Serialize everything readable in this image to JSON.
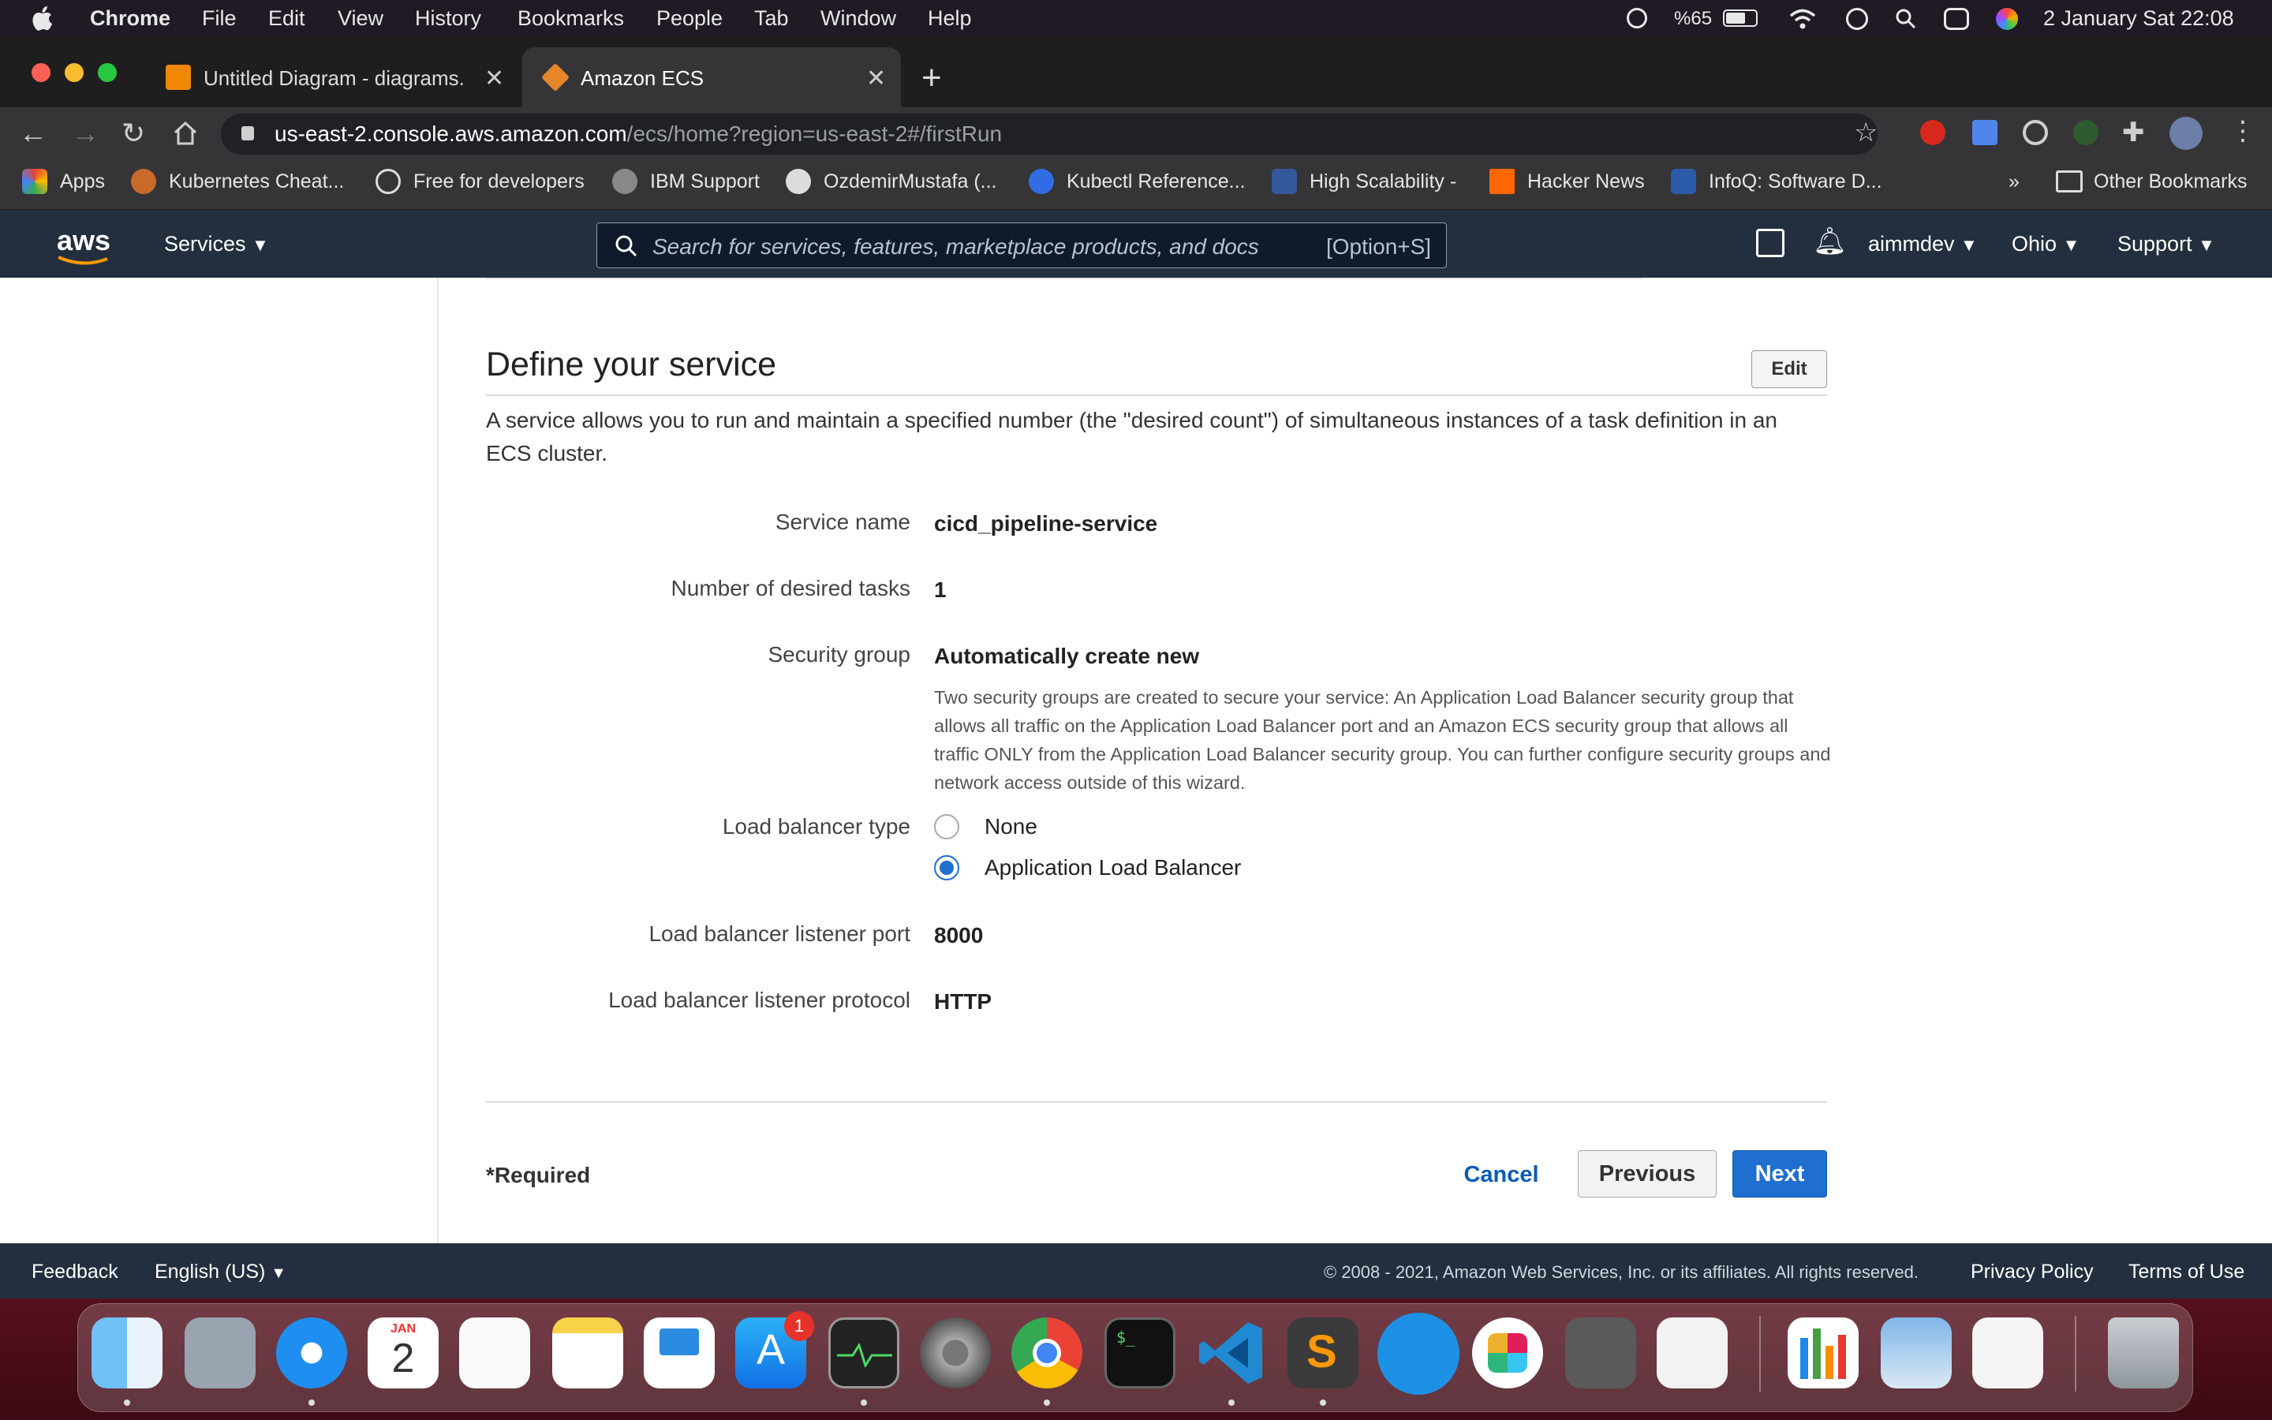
{
  "menubar": {
    "app": "Chrome",
    "items": [
      "File",
      "Edit",
      "View",
      "History",
      "Bookmarks",
      "People",
      "Tab",
      "Window",
      "Help"
    ],
    "battery": "%65",
    "datetime": "2 January Sat  22:08"
  },
  "tabs": [
    {
      "label": "Untitled Diagram - diagrams.net"
    },
    {
      "label": "Amazon ECS"
    }
  ],
  "omnibox": {
    "host": "us-east-2.console.aws.amazon.com",
    "path": "/ecs/home?region=us-east-2#/firstRun"
  },
  "bookmarks": {
    "items": [
      "Apps",
      "Kubernetes Cheat...",
      "Free for developers",
      "IBM Support",
      "OzdemirMustafa (...",
      "Kubectl Reference...",
      "High Scalability -",
      "Hacker News",
      "InfoQ: Software D..."
    ],
    "overflow": "»",
    "other": "Other Bookmarks"
  },
  "aws_nav": {
    "logo": "aws",
    "services": "Services",
    "search_placeholder": "Search for services, features, marketplace products, and docs",
    "search_shortcut": "[Option+S]",
    "user": "aimmdev",
    "region": "Ohio",
    "support": "Support"
  },
  "section": {
    "title": "Define your service",
    "edit": "Edit",
    "description": "A service allows you to run and maintain a specified number (the \"desired count\") of simultaneous instances of a task definition in an ECS cluster."
  },
  "fields": {
    "service_name_label": "Service name",
    "service_name_value": "cicd_pipeline-service",
    "desired_tasks_label": "Number of desired tasks",
    "desired_tasks_value": "1",
    "security_group_label": "Security group",
    "security_group_value": "Automatically create new",
    "security_group_help": "Two security groups are created to secure your service: An Application Load Balancer security group that allows all traffic on the Application Load Balancer port and an Amazon ECS security group that allows all traffic ONLY from the Application Load Balancer security group. You can further configure security groups and network access outside of this wizard.",
    "lb_type_label": "Load balancer type",
    "lb_option_none": "None",
    "lb_option_alb": "Application Load Balancer",
    "lb_port_label": "Load balancer listener port",
    "lb_port_value": "8000",
    "lb_protocol_label": "Load balancer listener protocol",
    "lb_protocol_value": "HTTP"
  },
  "actions": {
    "required": "*Required",
    "cancel": "Cancel",
    "previous": "Previous",
    "next": "Next"
  },
  "footer": {
    "feedback": "Feedback",
    "language": "English (US)",
    "copyright": "© 2008 - 2021, Amazon Web Services, Inc. or its affiliates. All rights reserved.",
    "privacy": "Privacy Policy",
    "terms": "Terms of Use"
  },
  "dock": {
    "calendar_month": "JAN",
    "calendar_day": "2",
    "appstore_badge": "1"
  },
  "colors": {
    "aws_nav": "#232f3e",
    "primary_button": "#1f6fd0",
    "link": "#0a5bb5"
  }
}
